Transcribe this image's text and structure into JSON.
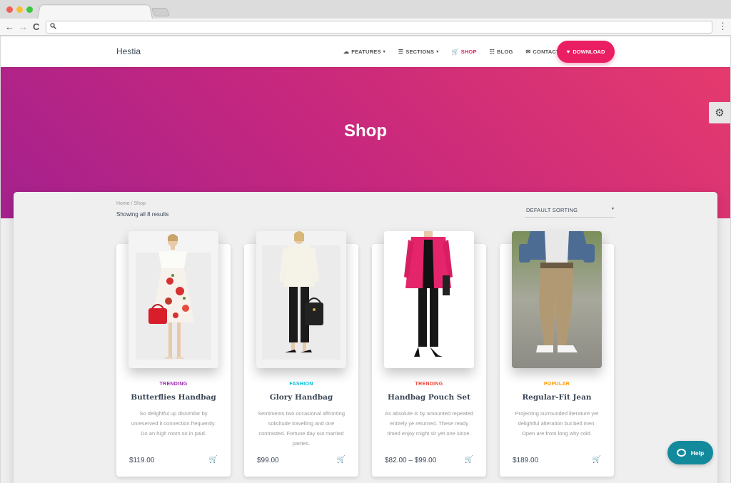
{
  "browser": {
    "nav": {
      "back": "←",
      "forward": "→",
      "reload": "C"
    },
    "menu": "⋮"
  },
  "site": {
    "brand": "Hestia",
    "nav": [
      {
        "label": "FEATURES",
        "icon": "cloud-icon",
        "glyph": "☁",
        "caret": "▾"
      },
      {
        "label": "SECTIONS",
        "icon": "sections-icon",
        "glyph": "☰",
        "caret": "▾"
      },
      {
        "label": "SHOP",
        "icon": "cart-icon",
        "glyph": "🛒",
        "caret": ""
      },
      {
        "label": "BLOG",
        "icon": "list-icon",
        "glyph": "☷",
        "caret": ""
      },
      {
        "label": "CONTACT",
        "icon": "envelope-icon",
        "glyph": "✉",
        "caret": ""
      }
    ],
    "download_label": "DOWNLOAD",
    "download_glyph": "♥"
  },
  "hero": {
    "title": "Shop"
  },
  "shop": {
    "breadcrumb": "Home / Shop",
    "result_count": "Showing all 8 results",
    "sort_label": "DEFAULT SORTING",
    "sort_caret": "▾"
  },
  "products": [
    {
      "category": "TRENDING",
      "category_color": "#9c27b0",
      "name": "Butterflies Handbag",
      "description": "So delightful up dissimilar by unreserved it connection frequently. Do an high room so in paid.",
      "price": "$119.00"
    },
    {
      "category": "FASHION",
      "category_color": "#00bcd4",
      "name": "Glory Handbag",
      "description": "Sentiments two occasional affronting solicitude travelling and one contrasted. Fortune day out married parties.",
      "price": "$99.00"
    },
    {
      "category": "TRENDING",
      "category_color": "#f44336",
      "name": "Handbag Pouch Set",
      "description": "As absolute is by amounted repeated entirely ye returned. These ready timed enjoy might sir yet one since.",
      "price": "$82.00 – $99.00"
    },
    {
      "category": "POPULAR",
      "category_color": "#ff9800",
      "name": "Regular-Fit Jean",
      "description": "Projecting surrounded literature yet delightful alteration but bed men. Open are from long why cold.",
      "price": "$189.00"
    }
  ],
  "cart_glyph": "🛒",
  "gear_glyph": "⚙",
  "help_label": "Help",
  "colors": {
    "accent": "#e91e63",
    "help": "#128a9c"
  }
}
